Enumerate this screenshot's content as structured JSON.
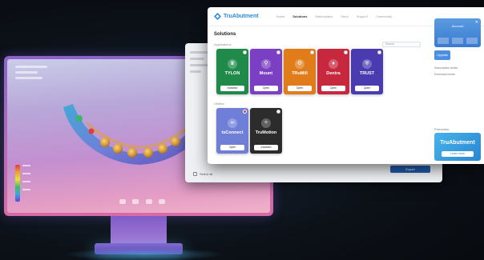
{
  "app": {
    "brand": "TruAbutment",
    "nav": [
      "Home",
      "Solutions",
      "Marketplace",
      "Store",
      "Support",
      "Community"
    ],
    "active_nav_index": 1,
    "section_title": "Solutions",
    "search_placeholder": "Search"
  },
  "groups": {
    "primary": "Applications",
    "secondary": "Utilities"
  },
  "apps": [
    {
      "name": "TYLON",
      "button": "Installed",
      "color": "#1f8a4a",
      "icon": "crown-icon",
      "badge": "white"
    },
    {
      "name": "Mount",
      "button": "Open",
      "color": "#7a3fc2",
      "icon": "mount-icon",
      "badge": "white"
    },
    {
      "name": "TRuMill",
      "button": "Open",
      "color": "#e07d1a",
      "icon": "mill-icon",
      "badge": "white"
    },
    {
      "name": "Dentra",
      "button": "Open",
      "color": "#c8283e",
      "icon": "tooth-icon",
      "badge": "white"
    },
    {
      "name": "TRUST",
      "button": "Open",
      "color": "#4a3bb0",
      "icon": "shield-icon",
      "badge": "white"
    },
    {
      "name": "tsConnect",
      "button": "Open",
      "color": "#6f7fd8",
      "icon": "link-icon",
      "badge": "red"
    },
    {
      "name": "TruMotion",
      "button": "Installed",
      "color": "#2c2c2c",
      "icon": "motion-icon",
      "badge": "white"
    }
  ],
  "right_panel": {
    "close_glyph": "✕",
    "title": "Account",
    "action": "Upgrade",
    "lines": [
      "Subscription active",
      "Download center"
    ],
    "section": "Promotion",
    "promo_title": "TruAbutment",
    "promo_button": "Learn more"
  },
  "back_window": {
    "checkbox_label": "Select all",
    "button": "Export"
  },
  "colors": {
    "brand_blue": "#2a8bd6",
    "panel_blue": "#3a7bd0",
    "promo_blue": "#2a86d0"
  }
}
